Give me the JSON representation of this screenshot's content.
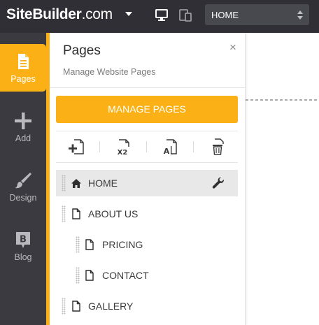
{
  "topbar": {
    "logo_main": "SiteBuilder",
    "logo_tld": ".com",
    "page_select_value": "HOME",
    "icons": {
      "menu_caret": "caret-down-icon",
      "desktop_view": "monitor-icon",
      "responsive_view": "devices-icon",
      "select_arrows": "updown-icon"
    }
  },
  "sidebar": {
    "items": [
      {
        "label": "Pages",
        "icon": "page-icon",
        "active": true
      },
      {
        "label": "Add",
        "icon": "plus-icon",
        "active": false
      },
      {
        "label": "Design",
        "icon": "brush-icon",
        "active": false
      },
      {
        "label": "Blog",
        "icon": "blog-icon",
        "active": false
      }
    ]
  },
  "panel": {
    "title": "Pages",
    "subtitle": "Manage Website Pages",
    "close_label": "×",
    "manage_button": "MANAGE PAGES",
    "tools": [
      {
        "name": "add-page",
        "icon": "add-page-icon"
      },
      {
        "name": "duplicate-page",
        "icon": "duplicate-page-icon"
      },
      {
        "name": "rename-page",
        "icon": "rename-page-icon"
      },
      {
        "name": "delete-page",
        "icon": "trash-icon"
      }
    ],
    "pages": [
      {
        "label": "HOME",
        "icon": "home-icon",
        "level": 0,
        "selected": true,
        "settings_icon": "wrench-icon"
      },
      {
        "label": "ABOUT US",
        "icon": "page-icon",
        "level": 0,
        "selected": false
      },
      {
        "label": "PRICING",
        "icon": "page-icon",
        "level": 1,
        "selected": false
      },
      {
        "label": "CONTACT",
        "icon": "page-icon",
        "level": 1,
        "selected": false
      },
      {
        "label": "GALLERY",
        "icon": "page-icon",
        "level": 0,
        "selected": false
      }
    ]
  },
  "colors": {
    "accent": "#fbb116",
    "topbar": "#2f2f35",
    "sidebar": "#3a3a40",
    "selected_row": "#e8e8e8"
  }
}
